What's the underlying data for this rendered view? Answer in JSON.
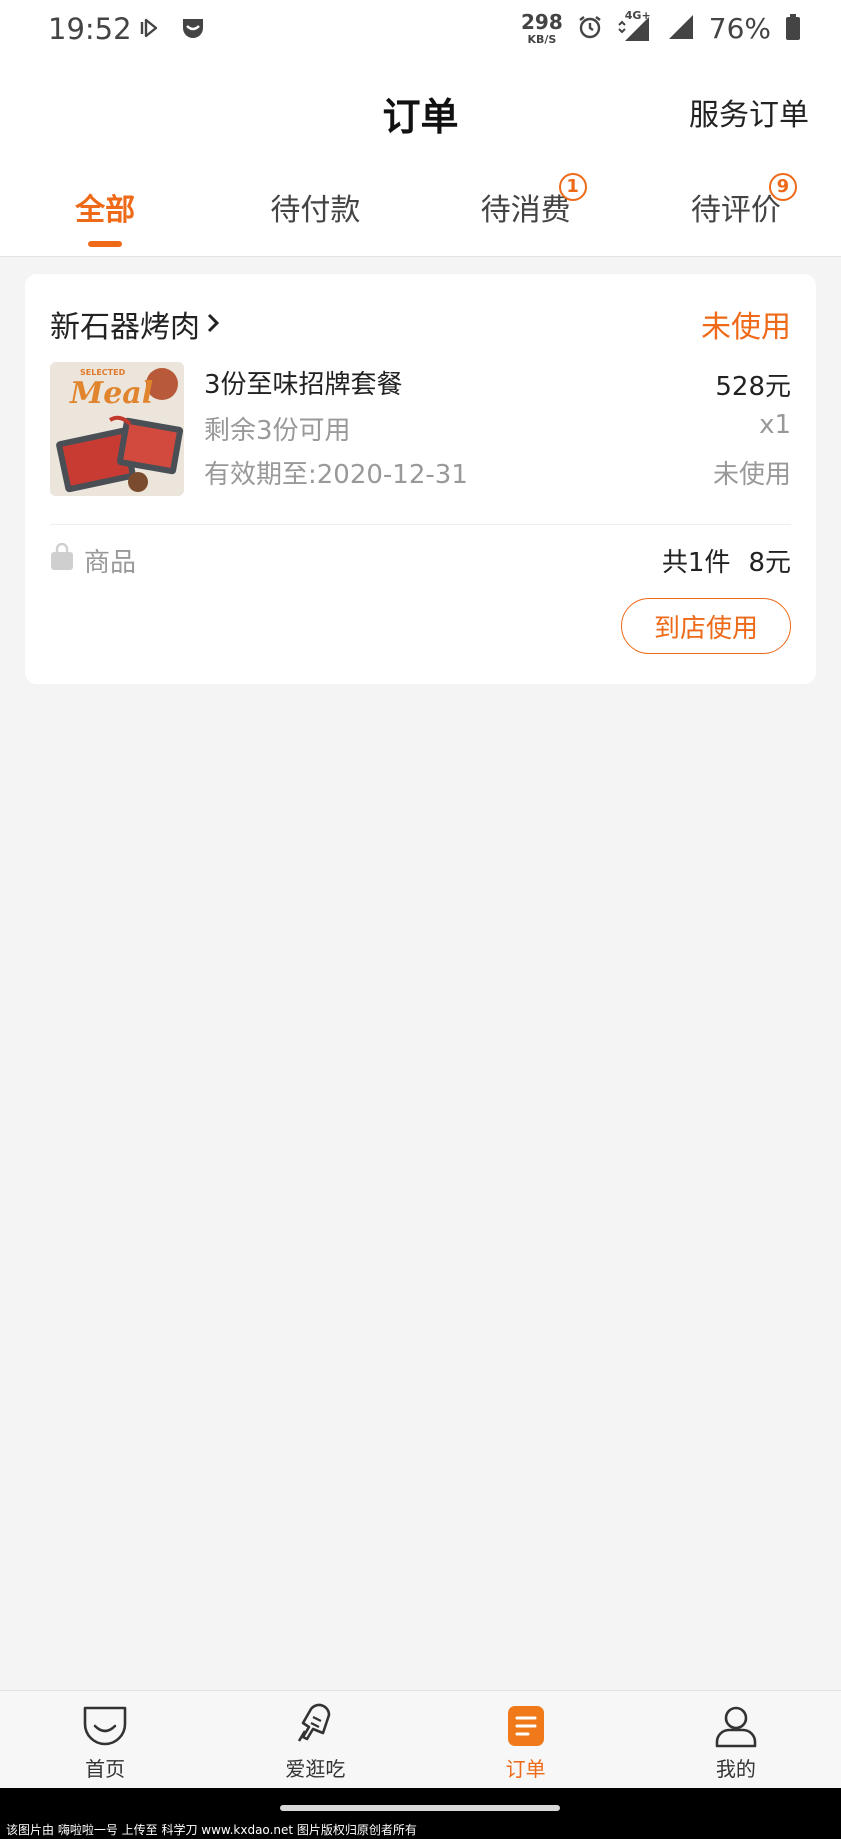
{
  "status_bar": {
    "time": "19:52",
    "net_speed": "298",
    "net_unit": "KB/S",
    "network_type": "4G+",
    "battery": "76%"
  },
  "header": {
    "title": "订单",
    "service_link": "服务订单"
  },
  "tabs": [
    {
      "label": "全部",
      "active": true,
      "badge": null
    },
    {
      "label": "待付款",
      "active": false,
      "badge": null
    },
    {
      "label": "待消费",
      "active": false,
      "badge": "1"
    },
    {
      "label": "待评价",
      "active": false,
      "badge": "9"
    }
  ],
  "order": {
    "shop_name": "新石器烤肉",
    "status": "未使用",
    "thumbnail_text": [
      "SELECTED",
      "Meal"
    ],
    "item_name": "3份至味招牌套餐",
    "price": "528元",
    "remaining": "剩余3份可用",
    "quantity": "x1",
    "expiry": "有效期至:2020-12-31",
    "item_status": "未使用",
    "goods_label": "商品",
    "total_count": "共1件",
    "total_price": "8元",
    "action_button": "到店使用"
  },
  "bottom_nav": [
    {
      "label": "首页",
      "icon": "home-icon"
    },
    {
      "label": "爱逛吃",
      "icon": "popsicle-icon"
    },
    {
      "label": "订单",
      "icon": "order-icon"
    },
    {
      "label": "我的",
      "icon": "profile-icon"
    }
  ],
  "watermark": "该图片由 嗨啦啦一号 上传至 科学刀 www.kxdao.net 图片版权归原创者所有",
  "colors": {
    "accent": "#ee6a18",
    "background": "#f4f4f4"
  }
}
